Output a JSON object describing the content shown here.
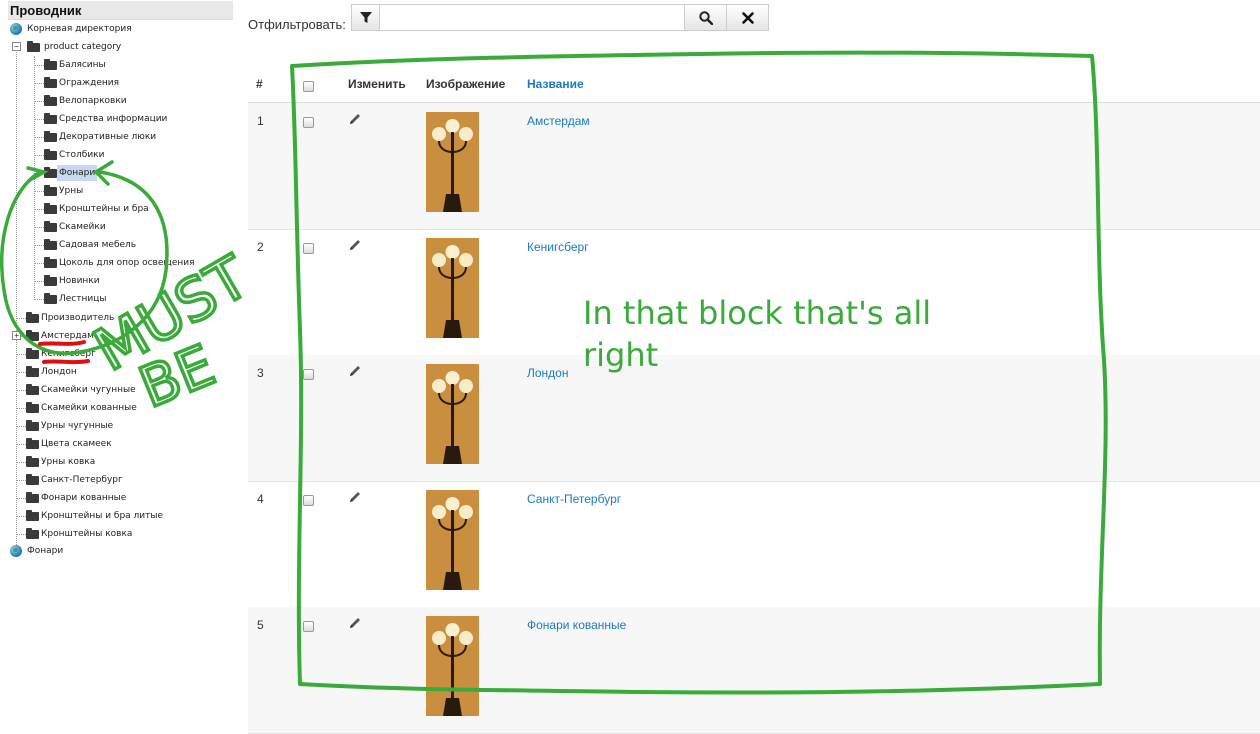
{
  "sidebar": {
    "title": "Проводник",
    "root_label": "Корневая директория",
    "category_label": "product category",
    "subcategories": [
      "Балясины",
      "Ограждения",
      "Велопарковки",
      "Средства информации",
      "Декоративные люки",
      "Столбики",
      "Фонари",
      "Урны",
      "Кронштейны и бра",
      "Скамейки",
      "Садовая мебель",
      "Цоколь для опор освещения",
      "Новинки",
      "Лестницы"
    ],
    "selected_subcategory": "Фонари",
    "other_categories": [
      "Производитель",
      "Амстердам",
      "Кенигсберг",
      "Лондон",
      "Скамейки чугунные",
      "Скамейки кованные",
      "Урны чугунные",
      "Цвета скамеек",
      "Урны ковка",
      "Санкт-Петербург",
      "Фонари кованные",
      "Кронштейны и бра литые",
      "Кронштейны ковка"
    ],
    "bottom_label": "Фонари"
  },
  "filter": {
    "label": "Отфильтровать:",
    "value": "",
    "filter_icon": "funnel-icon",
    "search_icon": "magnifier-icon",
    "clear_icon": "close-icon"
  },
  "table": {
    "headers": {
      "num": "#",
      "edit": "Изменить",
      "image": "Изображение",
      "name": "Название"
    },
    "rows": [
      {
        "num": "1",
        "title": "Амстердам"
      },
      {
        "num": "2",
        "title": "Кенигсберг"
      },
      {
        "num": "3",
        "title": "Лондон"
      },
      {
        "num": "4",
        "title": "Санкт-Петербург"
      },
      {
        "num": "5",
        "title": "Фонари кованные"
      }
    ]
  },
  "annotations": {
    "note_text": "In that block that's all right",
    "must": "MUST",
    "be": "BE",
    "annotation_color": "#3aaa3a",
    "underline_color": "#d11"
  },
  "colors": {
    "link": "#1a7bc0",
    "thumb_bg": "#c98f3f"
  }
}
